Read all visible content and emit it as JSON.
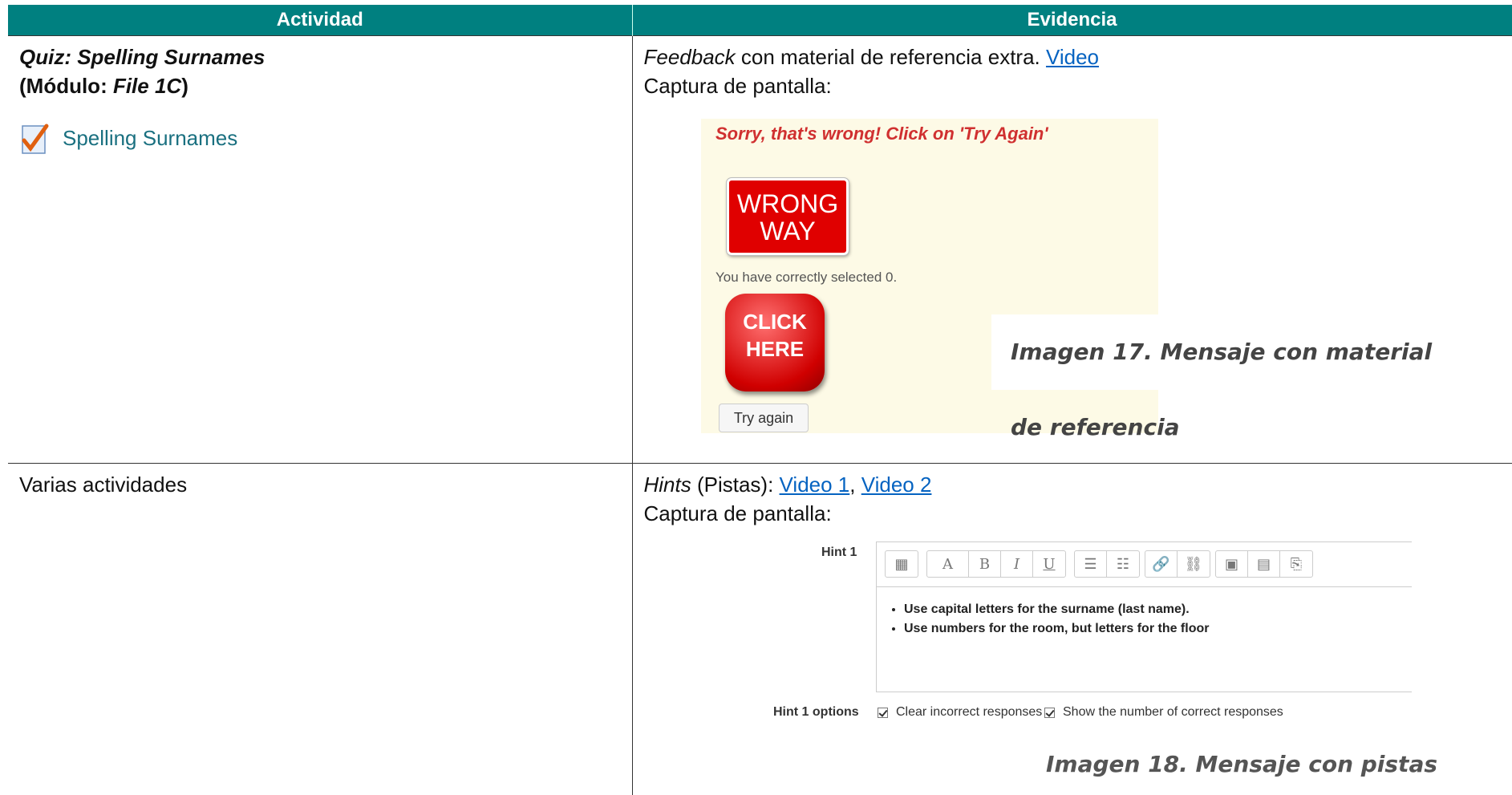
{
  "table": {
    "headers": [
      "Actividad",
      "Evidencia"
    ]
  },
  "row1": {
    "activity_title": "Quiz: Spelling Surnames",
    "module_open": "(Módulo: ",
    "module_name": "File 1C",
    "module_close": ")",
    "activity_link": "Spelling Surnames",
    "evidence_feedback_word": "Feedback",
    "evidence_feedback_rest": " con material de referencia extra. ",
    "evidence_link": "Video",
    "capture_label": "Captura de pantalla:",
    "screenshot": {
      "message": "Sorry, that's wrong! Click on 'Try Again'",
      "sign_line1": "WRONG",
      "sign_line2": "WAY",
      "selected_text": "You have correctly selected 0.",
      "click_line1": "CLICK",
      "click_line2": "HERE",
      "try_again": "Try again"
    },
    "caption": "Imagen 17. Mensaje con material de referencia"
  },
  "row2": {
    "activity": "Varias actividades",
    "hints_word": "Hints",
    "hints_rest": " (Pistas): ",
    "link1": "Video 1",
    "comma": ", ",
    "link2": "Video 2",
    "capture_label": "Captura de pantalla:",
    "screenshot": {
      "hint_label": "Hint 1",
      "bullets": [
        "Use capital letters for the surname (last name).",
        "Use numbers for the room, but letters for the floor"
      ],
      "options_label": "Hint 1 options",
      "option1": "Clear incorrect responses",
      "option2": "Show the number of correct responses",
      "toolbar_icons": [
        "toggle-toolbar-icon",
        "font-size-icon",
        "bold-icon",
        "italic-icon",
        "underline-icon",
        "bullet-list-icon",
        "numbered-list-icon",
        "link-icon",
        "unlink-icon",
        "image-icon",
        "media-icon",
        "manage-files-icon"
      ],
      "toolbar_glyphs": [
        "▦",
        "A",
        "B",
        "I",
        "U",
        "☰",
        "☷",
        "🔗",
        "⛓",
        "▣",
        "▤",
        "⎘"
      ]
    },
    "caption": "Imagen 18. Mensaje con pistas"
  }
}
